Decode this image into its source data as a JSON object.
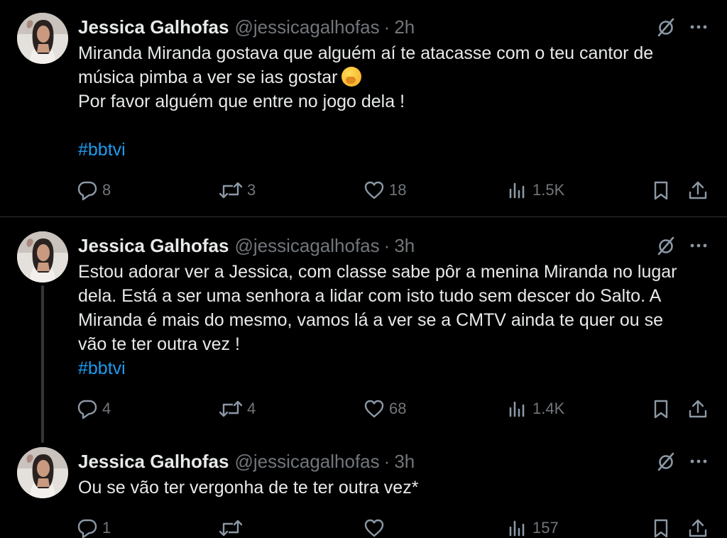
{
  "tweets": [
    {
      "name": "Jessica Galhofas",
      "handle": "@jessicagalhofas",
      "separator": "·",
      "time": "2h",
      "lines": [
        "Miranda Miranda gostava que alguém aí te atacasse com o teu cantor de",
        "música pimba a ver se ias gostar",
        "Por favor alguém que entre no jogo dela !",
        "",
        "#bbtvi"
      ],
      "emoji": "face-with-hand-over-mouth",
      "replies": "8",
      "retweets": "3",
      "likes": "18",
      "views": "1.5K"
    },
    {
      "name": "Jessica Galhofas",
      "handle": "@jessicagalhofas",
      "separator": "·",
      "time": "3h",
      "lines": [
        "Estou adorar ver a Jessica, com classe sabe pôr a menina Miranda no lugar",
        "dela. Está a ser uma senhora a lidar com isto tudo sem descer do Salto. A",
        "Miranda é mais do mesmo, vamos lá a ver se a CMTV ainda te quer ou se",
        "vão te ter outra vez !",
        "#bbtvi"
      ],
      "replies": "4",
      "retweets": "4",
      "likes": "68",
      "views": "1.4K"
    },
    {
      "name": "Jessica Galhofas",
      "handle": "@jessicagalhofas",
      "separator": "·",
      "time": "3h",
      "lines": [
        "Ou se vão ter vergonha de te ter outra vez*"
      ],
      "replies": "1",
      "retweets": "",
      "likes": "",
      "views": "157"
    }
  ],
  "icons": {
    "grok": "grok-slash-circle-icon",
    "more": "more-dots-icon",
    "reply": "reply-bubble-icon",
    "retweet": "retweet-icon",
    "like": "heart-icon",
    "views": "views-bars-icon",
    "bookmark": "bookmark-icon",
    "share": "share-upload-icon"
  },
  "colors": {
    "background": "#000000",
    "text": "#e7e9ea",
    "muted": "#71767b",
    "hashtag": "#1d9bf0",
    "divider": "#2f3336"
  }
}
